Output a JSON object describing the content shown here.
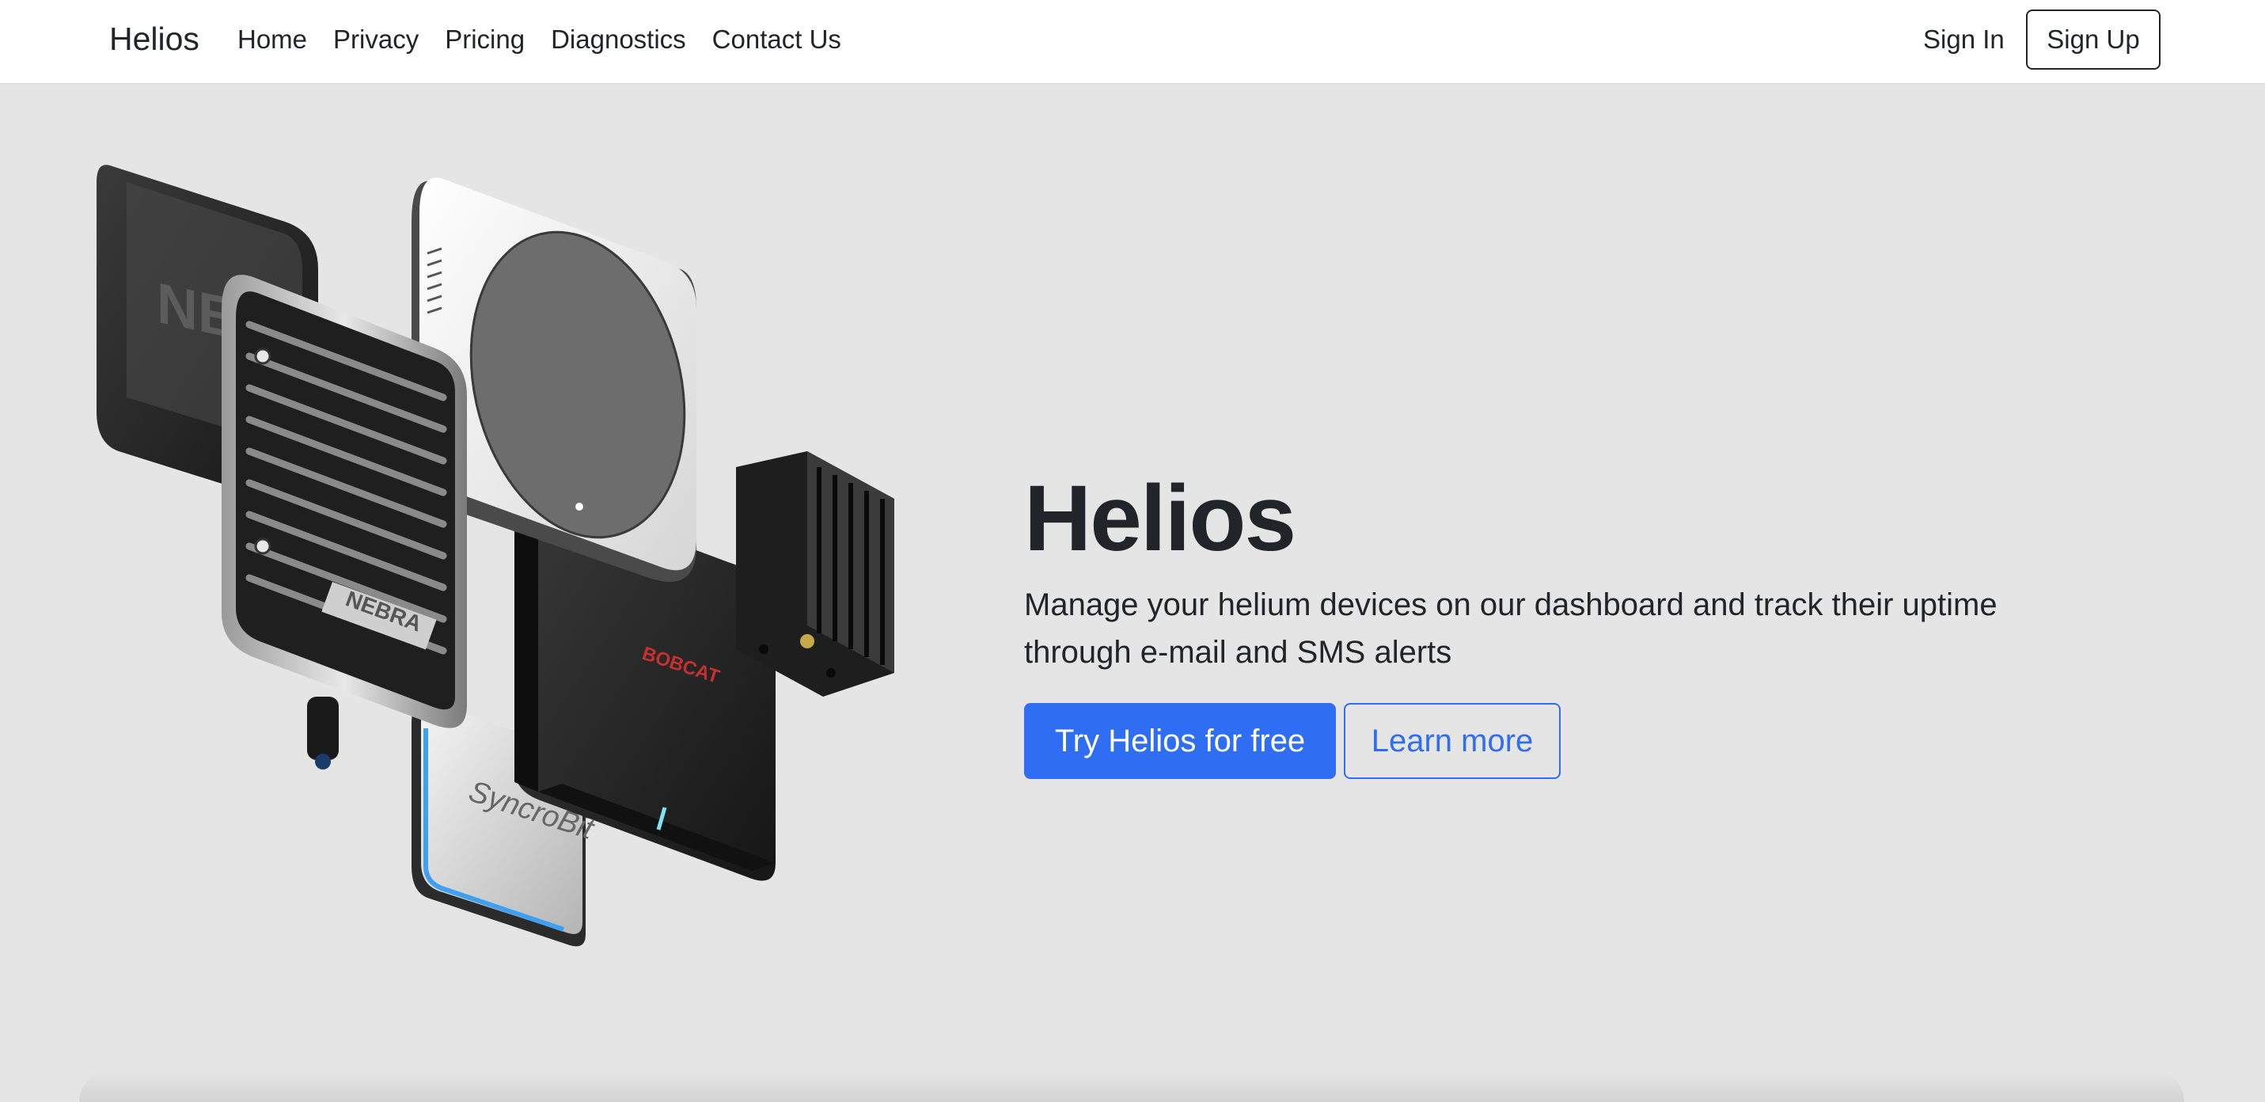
{
  "navbar": {
    "brand": "Helios",
    "links": [
      "Home",
      "Privacy",
      "Pricing",
      "Diagnostics",
      "Contact Us"
    ],
    "sign_in": "Sign In",
    "sign_up": "Sign Up"
  },
  "hero": {
    "illustration": {
      "nebra_label": "NEBRA",
      "bobcat_label": "BOBCAT",
      "syncrobit_label": "SyncroBit"
    },
    "title": "Helios",
    "subtitle": "Manage your helium devices on our dashboard and track their uptime through e-mail and SMS alerts",
    "primary_cta": "Try Helios for free",
    "secondary_cta": "Learn more"
  },
  "colors": {
    "accent": "#2f6ef2",
    "background": "#e5e5e5",
    "navbar": "#ffffff"
  }
}
